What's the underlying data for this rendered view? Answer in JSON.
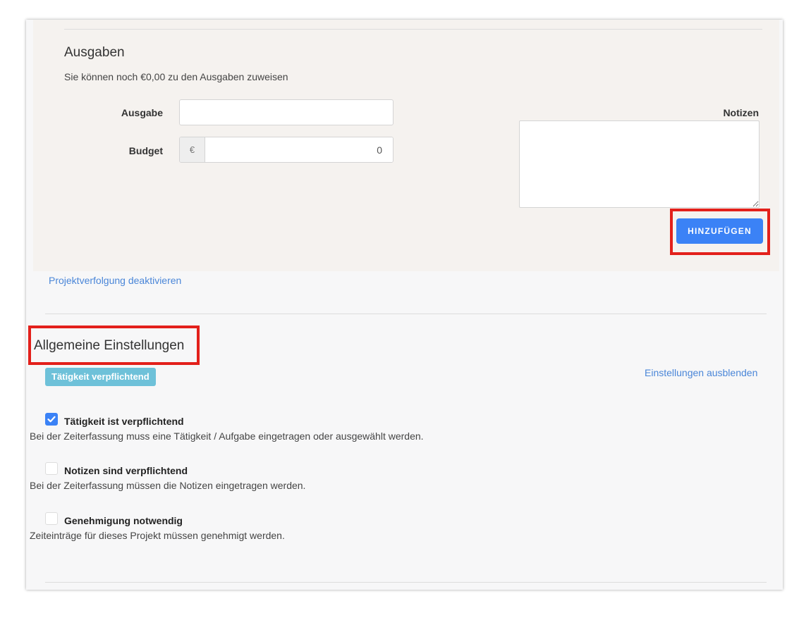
{
  "expenses": {
    "title": "Ausgaben",
    "subtitle": "Sie können noch €0,00 zu den Ausgaben zuweisen",
    "expense_label": "Ausgabe",
    "expense_value": "",
    "budget_label": "Budget",
    "currency_symbol": "€",
    "budget_value": "0",
    "notes_label": "Notizen",
    "notes_value": "",
    "add_button_label": "HINZUFÜGEN"
  },
  "disable_tracking_link": "Projektverfolgung deaktivieren",
  "settings": {
    "title": "Allgemeine Einstellungen",
    "badge": "Tätigkeit verpflichtend",
    "hide_link": "Einstellungen ausblenden",
    "options": [
      {
        "label": "Tätigkeit ist verpflichtend",
        "description": "Bei der Zeiterfassung muss eine Tätigkeit / Aufgabe eingetragen oder ausgewählt werden.",
        "checked": true
      },
      {
        "label": "Notizen sind verpflichtend",
        "description": "Bei der Zeiterfassung müssen die Notizen eingetragen werden.",
        "checked": false
      },
      {
        "label": "Genehmigung notwendig",
        "description": "Zeiteinträge für dieses Projekt müssen genehmigt werden.",
        "checked": false
      }
    ]
  },
  "colors": {
    "accent": "#3b82f6",
    "badge": "#6ec1d9",
    "link": "#4a86d8",
    "highlight": "#e3201b",
    "panel": "#f5f2ef"
  },
  "icons": {
    "checkbox_checked": "check-icon",
    "textarea_resize": "resize-handle-icon"
  }
}
